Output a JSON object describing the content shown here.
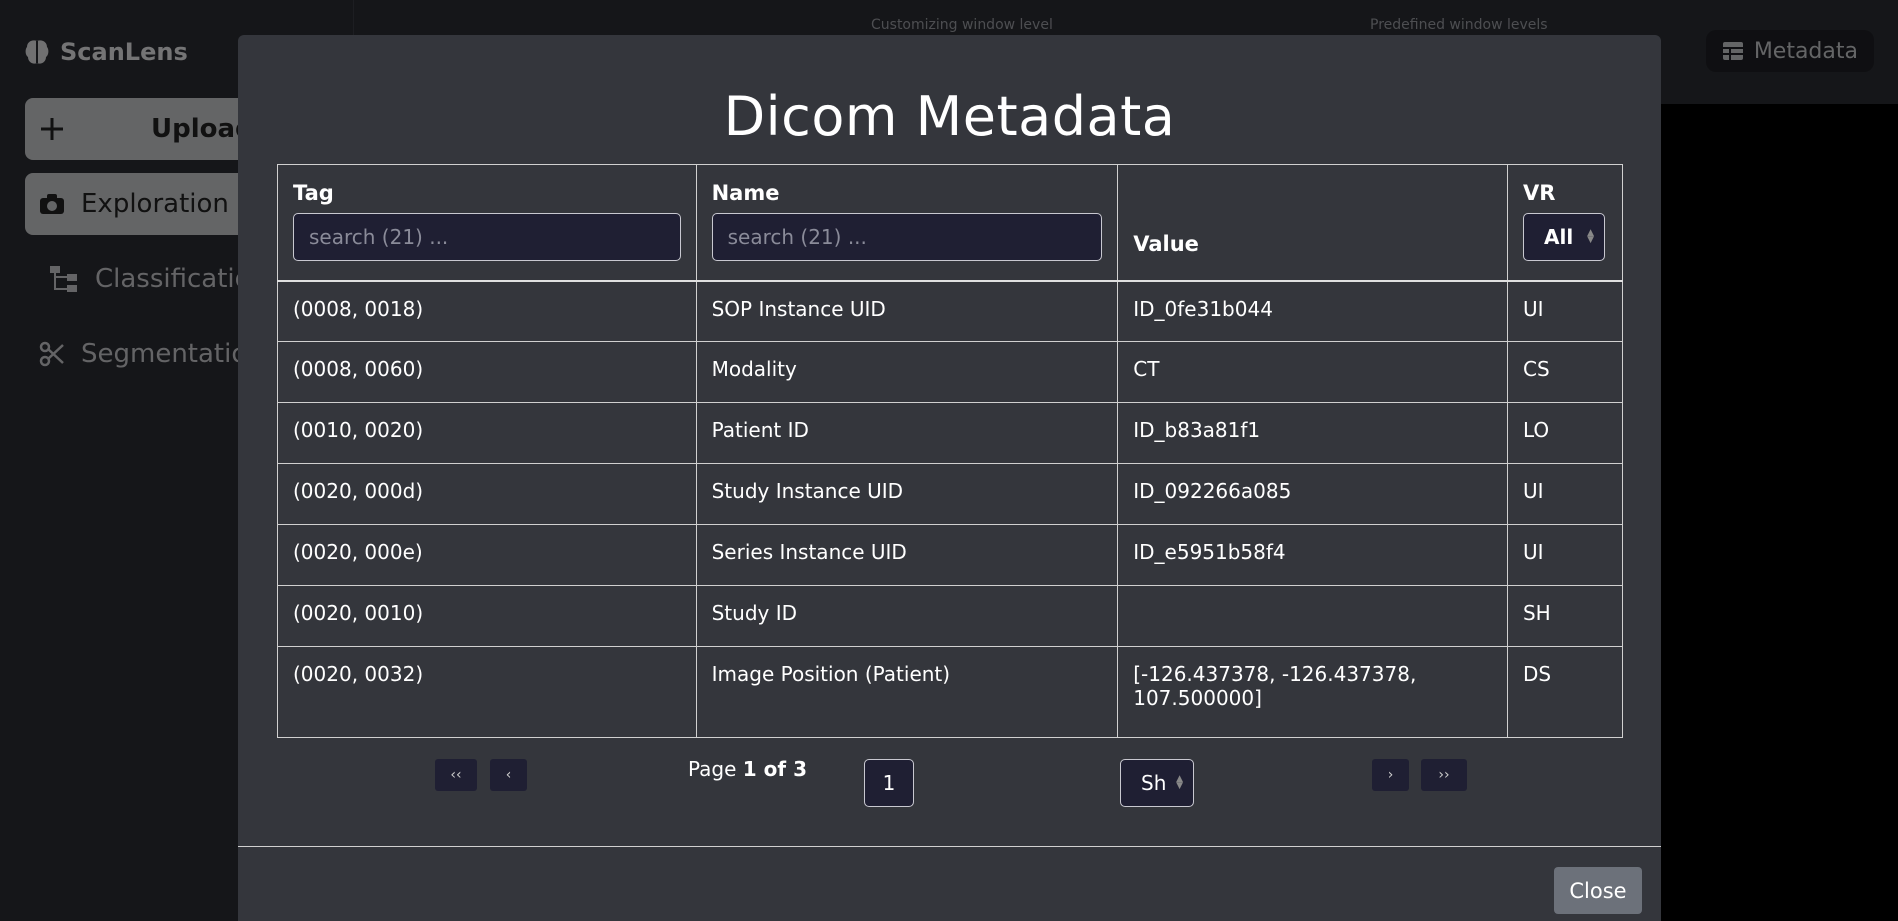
{
  "app": {
    "brand": "ScanLens",
    "nav": [
      {
        "label": "Upload",
        "icon": "plus-icon"
      },
      {
        "label": "Exploration",
        "icon": "camera-icon"
      },
      {
        "label": "Classification",
        "icon": "tree-icon"
      },
      {
        "label": "Segmentation",
        "icon": "scissors-icon"
      }
    ],
    "top_captions": [
      "Customizing window level",
      "Predefined window levels"
    ],
    "metadata_button": "Metadata"
  },
  "modal": {
    "title": "Dicom Metadata",
    "columns": {
      "tag": "Tag",
      "name": "Name",
      "value": "Value",
      "vr": "VR"
    },
    "tag_search_placeholder": "search (21) ...",
    "name_search_placeholder": "search (21) ...",
    "vr_filter_value": "All",
    "rows": [
      {
        "tag": "(0008, 0018)",
        "name": "SOP Instance UID",
        "value": "ID_0fe31b044",
        "vr": "UI"
      },
      {
        "tag": "(0008, 0060)",
        "name": "Modality",
        "value": "CT",
        "vr": "CS"
      },
      {
        "tag": "(0010, 0020)",
        "name": "Patient ID",
        "value": "ID_b83a81f1",
        "vr": "LO"
      },
      {
        "tag": "(0020, 000d)",
        "name": "Study Instance UID",
        "value": "ID_092266a085",
        "vr": "UI"
      },
      {
        "tag": "(0020, 000e)",
        "name": "Series Instance UID",
        "value": "ID_e5951b58f4",
        "vr": "UI"
      },
      {
        "tag": "(0020, 0010)",
        "name": "Study ID",
        "value": "",
        "vr": "SH"
      },
      {
        "tag": "(0020, 0032)",
        "name": "Image Position (Patient)",
        "value": "[-126.437378, -126.437378, 107.500000]",
        "vr": "DS"
      }
    ],
    "pagination": {
      "first": "‹‹",
      "prev": "‹",
      "next": "›",
      "last": "››",
      "page_prefix": "Page",
      "page_of": "1 of 3",
      "page_input": "1",
      "show_select": "Sh"
    },
    "close_label": "Close"
  }
}
